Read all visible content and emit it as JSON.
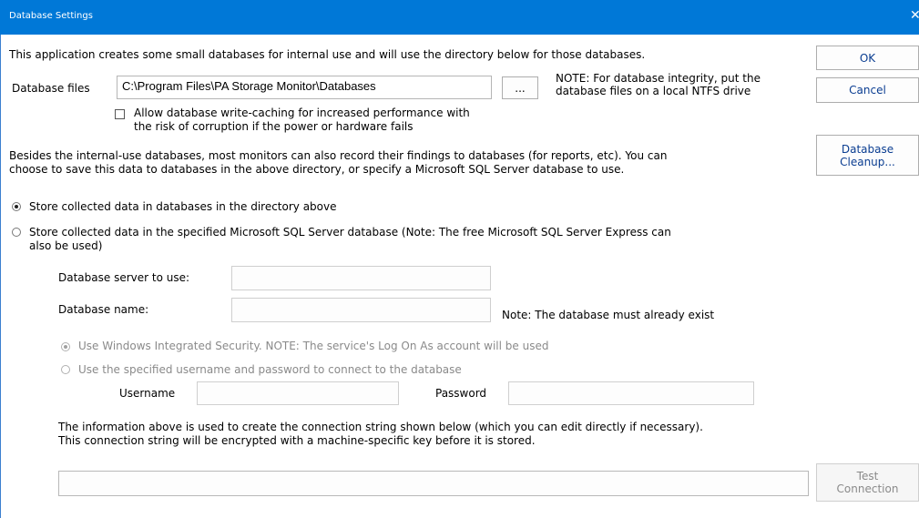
{
  "window": {
    "title": "Database Settings",
    "close_glyph": "✕"
  },
  "intro_text": "This application creates some small databases for internal use and will use the directory below for those databases.",
  "db_files": {
    "label": "Database files",
    "value": "C:\\Program Files\\PA Storage Monitor\\Databases",
    "browse_label": "...",
    "note": "NOTE: For database integrity, put the database files on a local NTFS drive"
  },
  "write_caching": {
    "checked": false,
    "label_line1": "Allow database write-caching for increased performance with",
    "label_line2": "the risk of corruption if the power or hardware fails"
  },
  "buttons": {
    "ok": "OK",
    "cancel": "Cancel",
    "cleanup_line1": "Database",
    "cleanup_line2": "Cleanup...",
    "test_line1": "Test",
    "test_line2": "Connection"
  },
  "besides_text_line1": "Besides the internal-use databases, most monitors can also record their findings to databases (for reports, etc).  You can",
  "besides_text_line2": "choose to save this data to databases in the above directory, or specify a Microsoft SQL Server database to use.",
  "storage_options": {
    "local": {
      "selected": true,
      "label": "Store collected data in databases in the directory above"
    },
    "sql": {
      "selected": false,
      "label_line1": "Store collected data in the specified Microsoft SQL Server database  (Note: The free Microsoft SQL Server Express can",
      "label_line2": "also be used)"
    }
  },
  "sql": {
    "server_label": "Database server to use:",
    "server_value": "",
    "name_label": "Database name:",
    "name_value": "",
    "name_note": "Note: The database must already exist",
    "auth_integrated": {
      "selected": true,
      "label": "Use Windows Integrated Security.  NOTE: The service's Log On As account will be used"
    },
    "auth_userpass": {
      "selected": false,
      "label": "Use the specified username and password to connect to the database"
    },
    "username_label": "Username",
    "username_value": "",
    "password_label": "Password",
    "password_value": "",
    "conn_info_line1": "The information above is used to create the connection string shown below (which you can edit directly if necessary).",
    "conn_info_line2": "This connection string will be encrypted with a machine-specific key before it is stored.",
    "connection_string": ""
  }
}
